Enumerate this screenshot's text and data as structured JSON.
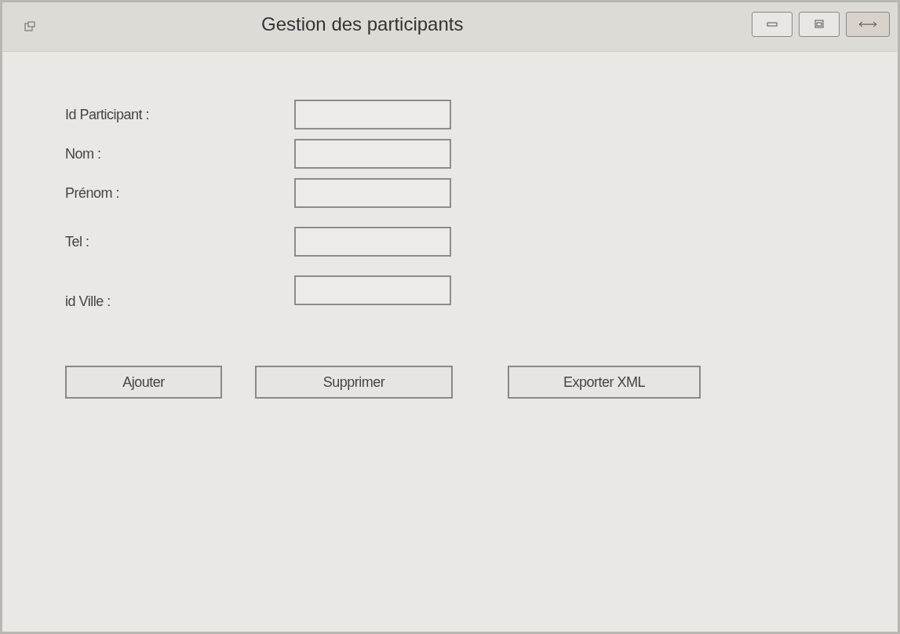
{
  "window": {
    "title": "Gestion des participants"
  },
  "fields": [
    {
      "label": "Id Participant :"
    },
    {
      "label": "Nom :"
    },
    {
      "label": "Prénom :"
    },
    {
      "label": "Tel :"
    },
    {
      "label": "id Ville :"
    }
  ],
  "buttons": [
    "Ajouter",
    "Supprimer",
    "Exporter XML"
  ]
}
